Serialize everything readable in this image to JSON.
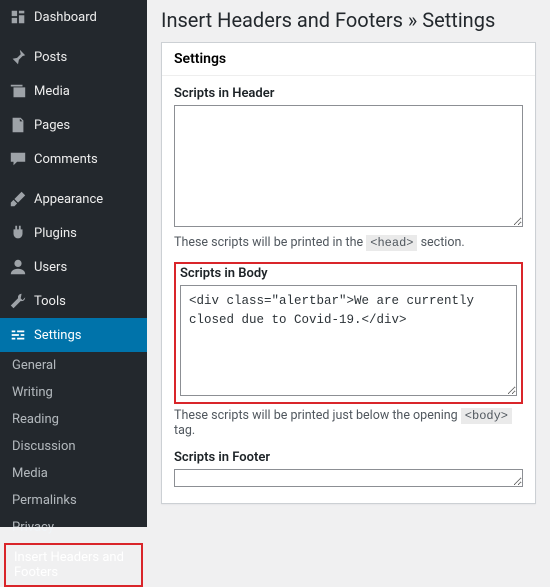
{
  "sidebar": {
    "items": [
      {
        "label": "Dashboard",
        "icon": "dashboard"
      },
      {
        "label": "Posts",
        "icon": "pin"
      },
      {
        "label": "Media",
        "icon": "media"
      },
      {
        "label": "Pages",
        "icon": "page"
      },
      {
        "label": "Comments",
        "icon": "comment"
      },
      {
        "label": "Appearance",
        "icon": "brush"
      },
      {
        "label": "Plugins",
        "icon": "plug"
      },
      {
        "label": "Users",
        "icon": "user"
      },
      {
        "label": "Tools",
        "icon": "wrench"
      },
      {
        "label": "Settings",
        "icon": "sliders"
      }
    ],
    "sub": [
      "General",
      "Writing",
      "Reading",
      "Discussion",
      "Media",
      "Permalinks",
      "Privacy",
      "Insert Headers and Footers"
    ]
  },
  "page": {
    "title": "Insert Headers and Footers » Settings",
    "panel_title": "Settings",
    "header_label": "Scripts in Header",
    "header_value": "",
    "header_help_pre": "These scripts will be printed in the ",
    "header_help_code": "<head>",
    "header_help_post": " section.",
    "body_label": "Scripts in Body",
    "body_value": "<div class=\"alertbar\">We are currently closed due to Covid-19.</div>",
    "body_help_pre": "These scripts will be printed just below the opening ",
    "body_help_code": "<body>",
    "body_help_post": " tag.",
    "footer_label": "Scripts in Footer",
    "footer_value": ""
  }
}
